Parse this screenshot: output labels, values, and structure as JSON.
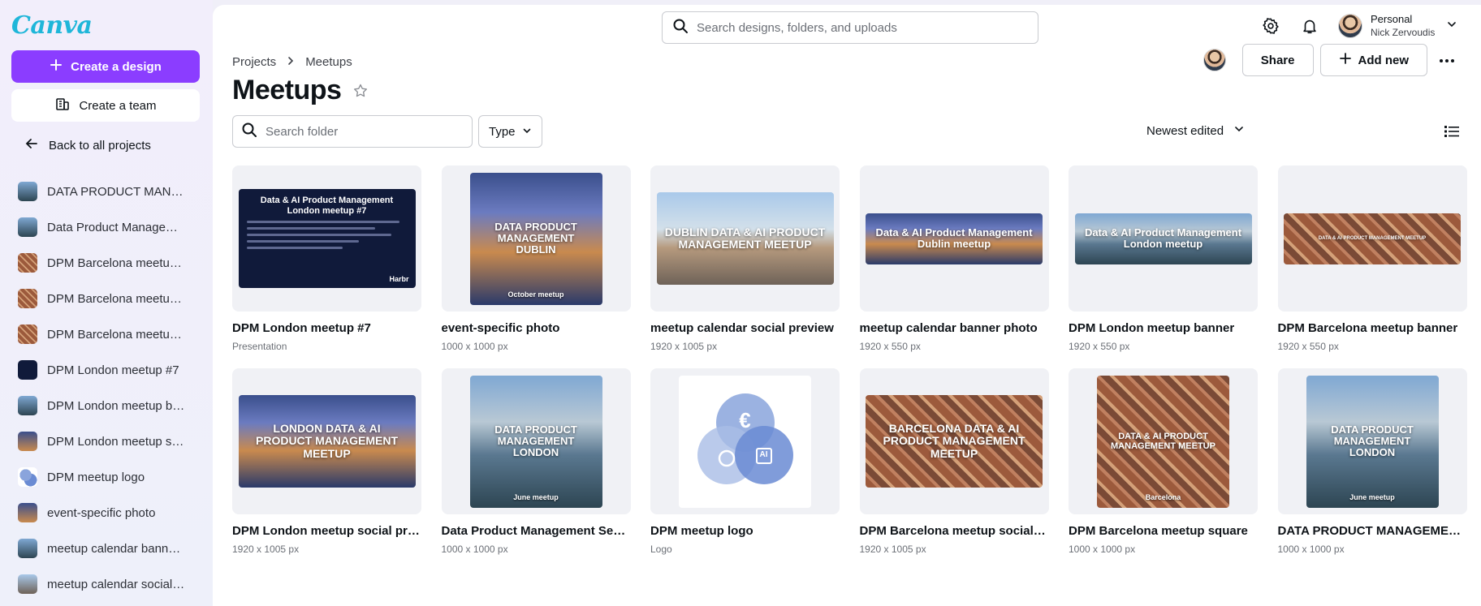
{
  "app": {
    "logo": "Canva"
  },
  "sidebar": {
    "create_design": "Create a design",
    "create_team": "Create a team",
    "back": "Back to all projects",
    "items": [
      {
        "label": "DATA PRODUCT MANAGEMENT LONDON",
        "thumb": "river"
      },
      {
        "label": "Data Product Management September",
        "thumb": "river"
      },
      {
        "label": "DPM Barcelona meetup square",
        "thumb": "barca"
      },
      {
        "label": "DPM Barcelona meetup social preview",
        "thumb": "barca"
      },
      {
        "label": "DPM Barcelona meetup banner",
        "thumb": "barca"
      },
      {
        "label": "DPM London meetup #7",
        "thumb": "pres"
      },
      {
        "label": "DPM London meetup banner",
        "thumb": "river"
      },
      {
        "label": "DPM London meetup social preview",
        "thumb": "city-night"
      },
      {
        "label": "DPM meetup logo",
        "thumb": "logo"
      },
      {
        "label": "event-specific photo",
        "thumb": "city-night"
      },
      {
        "label": "meetup calendar banner photo",
        "thumb": "river"
      },
      {
        "label": "meetup calendar social preview",
        "thumb": "dublin"
      }
    ]
  },
  "topbar": {
    "search_placeholder": "Search designs, folders, and uploads",
    "account_title": "Personal",
    "account_name": "Nick Zervoudis"
  },
  "header": {
    "breadcrumb_root": "Projects",
    "breadcrumb_current": "Meetups",
    "title": "Meetups",
    "share": "Share",
    "add_new": "Add new"
  },
  "filters": {
    "folder_search_placeholder": "Search folder",
    "type": "Type",
    "sort": "Newest edited"
  },
  "designs": [
    {
      "title": "DPM London meetup #7",
      "meta": "Presentation"
    },
    {
      "title": "event-specific photo",
      "meta": "1000 x 1000 px"
    },
    {
      "title": "meetup calendar social preview",
      "meta": "1920 x 1005 px"
    },
    {
      "title": "meetup calendar banner photo",
      "meta": "1920 x 550 px"
    },
    {
      "title": "DPM London meetup banner",
      "meta": "1920 x 550 px"
    },
    {
      "title": "DPM Barcelona meetup banner",
      "meta": "1920 x 550 px"
    },
    {
      "title": "DPM London meetup social preview",
      "meta": "1920 x 1005 px"
    },
    {
      "title": "Data Product Management September",
      "meta": "1000 x 1000 px"
    },
    {
      "title": "DPM meetup logo",
      "meta": "Logo"
    },
    {
      "title": "DPM Barcelona meetup social preview",
      "meta": "1920 x 1005 px"
    },
    {
      "title": "DPM Barcelona meetup square",
      "meta": "1000 x 1000 px"
    },
    {
      "title": "DATA PRODUCT MANAGEMENT LONDON",
      "meta": "1000 x 1000 px"
    }
  ],
  "thumb_text": {
    "pres_title": "Data & AI Product Management London meetup #7",
    "pres_brand": "Harbr",
    "event_title": "DATA PRODUCT MANAGEMENT DUBLIN",
    "event_sub": "October meetup",
    "dublin_social": "DUBLIN DATA & AI PRODUCT MANAGEMENT MEETUP",
    "dublin_banner": "Data & AI Product Management Dublin meetup",
    "london_banner": "Data & AI Product Management London meetup",
    "barca_banner": "DATA & AI PRODUCT MANAGEMENT MEETUP",
    "london_social": "LONDON DATA & AI PRODUCT MANAGEMENT MEETUP",
    "london_square": "DATA PRODUCT MANAGEMENT LONDON",
    "june_sub": "June meetup",
    "logo_euro": "€",
    "logo_ai": "AI",
    "barca_social": "BARCELONA DATA & AI PRODUCT MANAGEMENT MEETUP",
    "barca_square": "DATA & AI PRODUCT MANAGEMENT MEETUP",
    "barca_sub": "Barcelona"
  },
  "colors": {
    "accent": "#8b3dff",
    "logo": "#1fb6d9"
  }
}
